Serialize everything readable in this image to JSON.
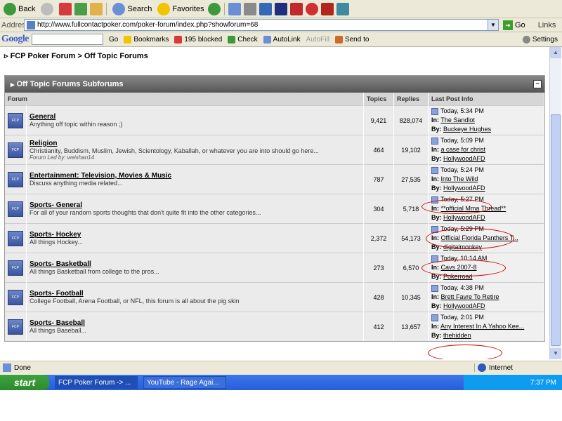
{
  "toolbar": {
    "back": "Back",
    "search": "Search",
    "favorites": "Favorites"
  },
  "address": {
    "label": "Address",
    "url": "http://www.fullcontactpoker.com/poker-forum/index.php?showforum=68",
    "go": "Go",
    "links": "Links"
  },
  "google": {
    "logo": "Google",
    "go": "Go",
    "bookmarks": "Bookmarks",
    "blocked": "195 blocked",
    "check": "Check",
    "autolink": "AutoLink",
    "autofill": "AutoFill",
    "sendto": "Send to",
    "settings": "Settings"
  },
  "breadcrumb": {
    "root": "FCP Poker Forum",
    "sep": ">",
    "current": "Off Topic Forums"
  },
  "box": {
    "title": "Off Topic Forums Subforums"
  },
  "columns": {
    "forum": "Forum",
    "topics": "Topics",
    "replies": "Replies",
    "last": "Last Post Info"
  },
  "forums": [
    {
      "name": "General",
      "desc": "Anything off topic within reason ;)",
      "led": "",
      "topics": "9,421",
      "replies": "828,074",
      "time": "Today, 5:34 PM",
      "in": "The Sandlot",
      "by": "Buckeye Hughes"
    },
    {
      "name": "Religion",
      "desc": "Christianity, Buddism, Muslim, Jewish, Scientology, Kaballah, or whatever you are into should go here...",
      "led": "Forum Led by: weishan14",
      "topics": "464",
      "replies": "19,102",
      "time": "Today, 5:09 PM",
      "in": "a case for christ",
      "by": "HollywoodAFD"
    },
    {
      "name": "Entertainment: Television, Movies & Music",
      "desc": "Discuss anything media related...",
      "led": "",
      "topics": "787",
      "replies": "27,535",
      "time": "Today, 5:24 PM",
      "in": "Into The Wild",
      "by": "HollywoodAFD"
    },
    {
      "name": "Sports- General",
      "desc": "For all of your random sports thoughts that don't quite fit into the other categories...",
      "led": "",
      "topics": "304",
      "replies": "5,718",
      "time": "Today, 5:27 PM",
      "in": "**official Mma Thread**",
      "by": "HollywoodAFD"
    },
    {
      "name": "Sports- Hockey",
      "desc": "All things Hockey...",
      "led": "",
      "topics": "2,372",
      "replies": "54,173",
      "time": "Today, 5:29 PM",
      "in": "Official Florida Panthers T...",
      "by": "digitalmonkey"
    },
    {
      "name": "Sports- Basketball",
      "desc": "All things Basketball from college to the pros...",
      "led": "",
      "topics": "273",
      "replies": "6,570",
      "time": "Today, 10:14 AM",
      "in": "Cavs 2007-8",
      "by": "Pokerroad"
    },
    {
      "name": "Sports- Football",
      "desc": "College Football, Arena Football, or NFL, this forum is all about the pig skin",
      "led": "",
      "topics": "428",
      "replies": "10,345",
      "time": "Today, 4:38 PM",
      "in": "Brett Favre To Retire",
      "by": "HollywoodAFD"
    },
    {
      "name": "Sports- Baseball",
      "desc": "All things Baseball...",
      "led": "",
      "topics": "412",
      "replies": "13,657",
      "time": "Today, 2:01 PM",
      "in": "Any Interest In A Yahoo Kee...",
      "by": "thehidden"
    }
  ],
  "labels": {
    "in": "In:",
    "by": "By:"
  },
  "status": {
    "text": "Done",
    "zone": "Internet"
  },
  "taskbar": {
    "start": "start",
    "task1": "FCP Poker Forum -> ...",
    "task2": "YouTube - Rage Agai...",
    "clock": "7:37 PM"
  }
}
